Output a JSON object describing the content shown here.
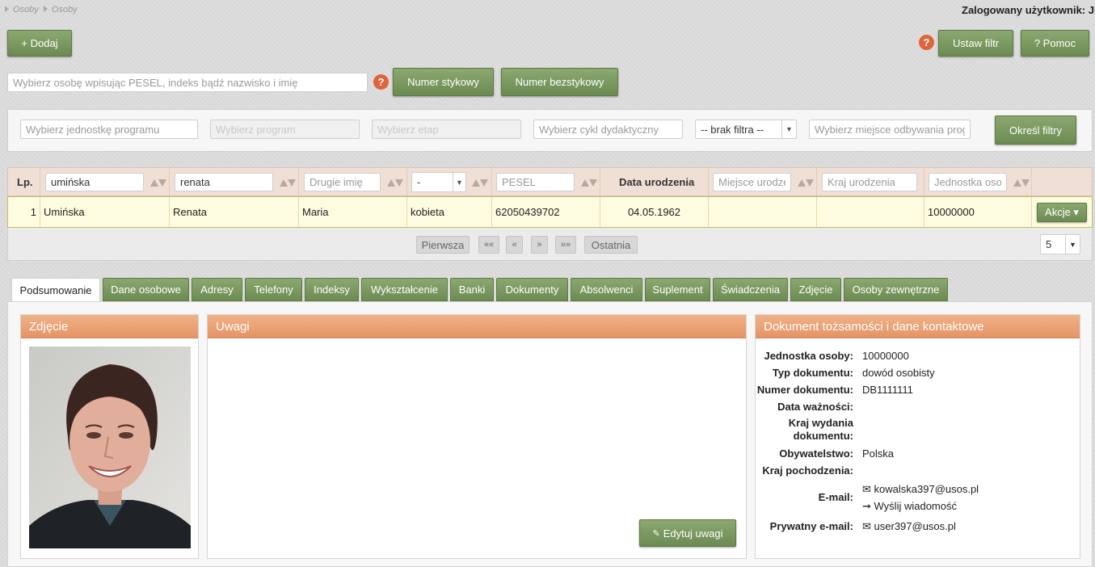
{
  "breadcrumb": [
    "Osoby",
    "Osoby"
  ],
  "user_info": "Zalogowany użytkownik: JMI",
  "toolbar": {
    "add_label": "+ Dodaj",
    "help_icon_text": "?",
    "set_filter_label": "Ustaw filtr",
    "help_label": "? Pomoc"
  },
  "search": {
    "placeholder": "Wybierz osobę wpisując PESEL, indeks bądź nazwisko i imię",
    "help_icon_text": "?",
    "numer_stykowy": "Numer stykowy",
    "numer_bezstykowy": "Numer bezstykowy"
  },
  "filters": {
    "unit_placeholder": "Wybierz jednostkę programu",
    "program_placeholder": "Wybierz program",
    "stage_placeholder": "Wybierz etap",
    "cycle_placeholder": "Wybierz cykl dydaktyczny",
    "select_value": "-- brak filtra --",
    "place_placeholder": "Wybierz miejsce odbywania prog",
    "apply_label": "Określ filtry"
  },
  "grid": {
    "header_lp": "Lp.",
    "surname_value": "umińska",
    "name_value": "renata",
    "second_name_placeholder": "Drugie imię",
    "gender_value": "-",
    "pesel_placeholder": "PESEL",
    "birthdate_header": "Data urodzenia",
    "birthplace_placeholder": "Miejsce urodzenia",
    "country_placeholder": "Kraj urodzenia",
    "unit_placeholder": "Jednostka osoby",
    "row": {
      "lp": "1",
      "surname": "Umińska",
      "name": "Renata",
      "second_name": "Maria",
      "gender": "kobieta",
      "pesel": "62050439702",
      "birthdate": "04.05.1962",
      "birthplace": "",
      "country": "",
      "unit": "10000000",
      "actions_label": "Akcje ▾"
    }
  },
  "pager": {
    "first": "Pierwsza",
    "prev_prev": "««",
    "prev": "«",
    "next": "»",
    "next_next": "»»",
    "last": "Ostatnia",
    "page_size": "5"
  },
  "tabs": [
    "Podsumowanie",
    "Dane osobowe",
    "Adresy",
    "Telefony",
    "Indeksy",
    "Wykształcenie",
    "Banki",
    "Dokumenty",
    "Absolwenci",
    "Suplement",
    "Świadczenia",
    "Zdjęcie",
    "Osoby zewnętrzne"
  ],
  "photo_panel": {
    "title": "Zdjęcie"
  },
  "notes_panel": {
    "title": "Uwagi",
    "edit_label": "Edytuj uwagi"
  },
  "doc_panel": {
    "title": "Dokument tożsamości i dane kontaktowe",
    "unit_label": "Jednostka osoby:",
    "unit_value": "10000000",
    "doc_type_label": "Typ dokumentu:",
    "doc_type_value": "dowód osobisty",
    "doc_number_label": "Numer dokumentu:",
    "doc_number_value": "DB1111111",
    "validity_label": "Data ważności:",
    "validity_value": "",
    "issue_country_label": "Kraj wydania dokumentu:",
    "issue_country_value": "",
    "citizenship_label": "Obywatelstwo:",
    "citizenship_value": "Polska",
    "origin_label": "Kraj pochodzenia:",
    "origin_value": "",
    "email_label": "E-mail:",
    "email_value": "kowalska397@usos.pl",
    "send_message": "Wyślij wiadomość",
    "private_email_label": "Prywatny e-mail:",
    "private_email_value": "user397@usos.pl"
  }
}
